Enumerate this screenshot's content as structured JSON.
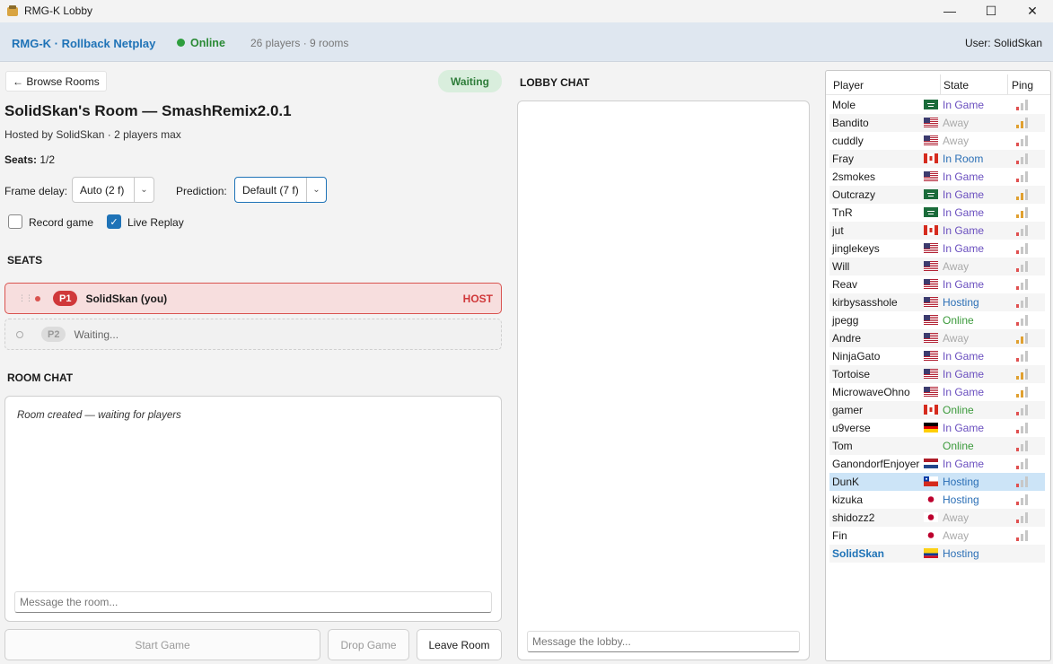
{
  "window": {
    "title": "RMG-K Lobby",
    "min_glyph": "—",
    "max_glyph": "☐",
    "close_glyph": "✕"
  },
  "header": {
    "brand": "RMG-K · Rollback Netplay",
    "status": "Online",
    "stats": "26 players  ·  9 rooms",
    "user": "User: SolidSkan",
    "status_color": "#2e9e3e"
  },
  "room": {
    "back_label": "← Browse Rooms",
    "state_pill": "Waiting",
    "title": "SolidSkan's Room — SmashRemix2.0.1",
    "subtitle": "Hosted by SolidSkan  ·  2 players max",
    "seats_label": "Seats:",
    "seats_value": "1/2",
    "frame_delay_label": "Frame delay:",
    "frame_delay_value": "Auto (2 f)",
    "prediction_label": "Prediction:",
    "prediction_value": "Default (7 f)",
    "record_game_label": "Record game",
    "record_game_checked": false,
    "live_replay_label": "Live Replay",
    "live_replay_checked": true
  },
  "seats": {
    "heading": "SEATS",
    "items": [
      {
        "badge": "P1",
        "name": "SolidSkan  (you)",
        "tag": "HOST"
      },
      {
        "badge": "P2",
        "name": "Waiting..."
      }
    ]
  },
  "room_chat": {
    "heading": "ROOM CHAT",
    "messages": [
      "Room created — waiting for players"
    ],
    "placeholder": "Message the room..."
  },
  "lobby_chat": {
    "heading": "LOBBY CHAT",
    "placeholder": "Message the lobby..."
  },
  "actions": {
    "start": "Start Game",
    "drop": "Drop Game",
    "leave": "Leave Room"
  },
  "players": {
    "columns": [
      "Player",
      "State",
      "Ping"
    ],
    "rows": [
      {
        "name": "Mole",
        "flag": "sa",
        "state": "In Game",
        "ping": 1
      },
      {
        "name": "Bandito",
        "flag": "us",
        "state": "Away",
        "ping": 2
      },
      {
        "name": "cuddly",
        "flag": "us",
        "state": "Away",
        "ping": 1
      },
      {
        "name": "Fray",
        "flag": "ca",
        "state": "In Room",
        "ping": 1
      },
      {
        "name": "2smokes",
        "flag": "us",
        "state": "In Game",
        "ping": 1
      },
      {
        "name": "Outcrazy",
        "flag": "sa",
        "state": "In Game",
        "ping": 2
      },
      {
        "name": "TnR",
        "flag": "sa",
        "state": "In Game",
        "ping": 2
      },
      {
        "name": "jut",
        "flag": "ca",
        "state": "In Game",
        "ping": 1
      },
      {
        "name": "jinglekeys",
        "flag": "us",
        "state": "In Game",
        "ping": 1
      },
      {
        "name": "Will",
        "flag": "us",
        "state": "Away",
        "ping": 1
      },
      {
        "name": "Reav",
        "flag": "us",
        "state": "In Game",
        "ping": 1
      },
      {
        "name": "kirbysasshole",
        "flag": "us",
        "state": "Hosting",
        "ping": 1
      },
      {
        "name": "jpegg",
        "flag": "us",
        "state": "Online",
        "ping": 1
      },
      {
        "name": "Andre",
        "flag": "us",
        "state": "Away",
        "ping": 2
      },
      {
        "name": "NinjaGato",
        "flag": "us",
        "state": "In Game",
        "ping": 1
      },
      {
        "name": "Tortoise",
        "flag": "us",
        "state": "In Game",
        "ping": 2
      },
      {
        "name": "MicrowaveOhno",
        "flag": "us",
        "state": "In Game",
        "ping": 2
      },
      {
        "name": "gamer",
        "flag": "ca",
        "state": "Online",
        "ping": 1
      },
      {
        "name": "u9verse",
        "flag": "de",
        "state": "In Game",
        "ping": 1
      },
      {
        "name": "Tom",
        "flag": "",
        "state": "Online",
        "ping": 1
      },
      {
        "name": "GanondorfEnjoyer",
        "flag": "nl",
        "state": "In Game",
        "ping": 1
      },
      {
        "name": "DunK",
        "flag": "cl",
        "state": "Hosting",
        "ping": 1,
        "selected": true
      },
      {
        "name": "kizuka",
        "flag": "jp",
        "state": "Hosting",
        "ping": 1
      },
      {
        "name": "shidozz2",
        "flag": "jp",
        "state": "Away",
        "ping": 1
      },
      {
        "name": "Fin",
        "flag": "jp",
        "state": "Away",
        "ping": 1
      },
      {
        "name": "SolidSkan",
        "flag": "co",
        "state": "Hosting",
        "ping": 0,
        "me": true
      }
    ]
  }
}
